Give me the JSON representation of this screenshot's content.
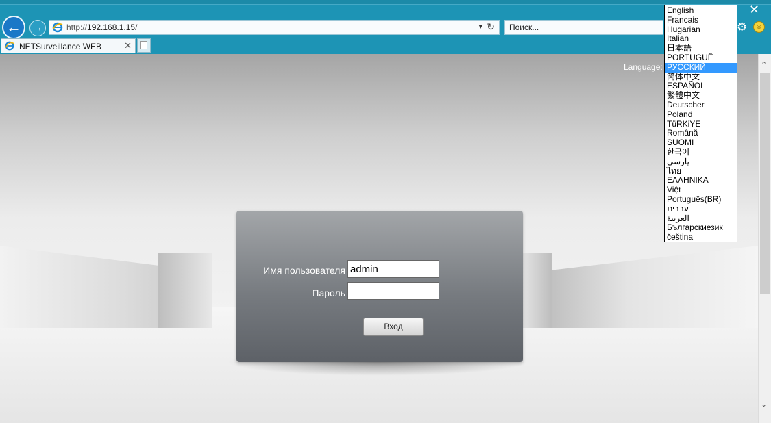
{
  "browser": {
    "address": {
      "protocol": "http://",
      "host": "192.168.1.15",
      "path": "/"
    },
    "search": {
      "placeholder": "Поиск..."
    },
    "tab": {
      "title": "NETSurveillance WEB"
    }
  },
  "page": {
    "language_label": "Language:",
    "login": {
      "username_label": "Имя пользователя",
      "username_value": "admin",
      "password_label": "Пароль",
      "password_value": "",
      "submit_label": "Вход"
    },
    "language_dropdown": {
      "selected": "РУССКИЙ",
      "options": [
        "English",
        "Francais",
        "Hugarian",
        "Italian",
        "日本語",
        "PORTUGUÊ",
        "РУССКИЙ",
        "简体中文",
        "ESPAÑOL",
        "繁體中文",
        "Deutscher",
        "Poland",
        "TüRKiYE",
        "Română",
        "SUOMI",
        "한국어",
        "پارسی",
        "ไทย",
        "ΕΛΛΗΝΙΚΑ",
        "Việt",
        "Português(BR)",
        "עברית",
        "العربية",
        "Българскиезик",
        "čeština"
      ]
    }
  }
}
